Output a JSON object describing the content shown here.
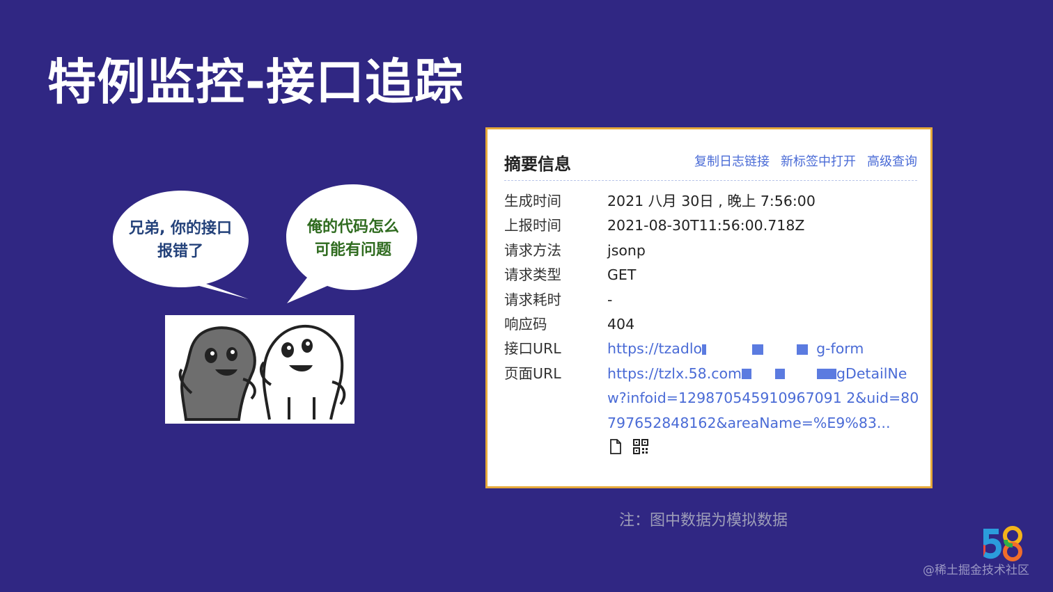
{
  "slide": {
    "title": "特例监控-接口追踪",
    "note": "注：图中数据为模拟数据",
    "watermark": "@稀土掘金技术社区"
  },
  "bubbles": {
    "left": {
      "line1": "兄弟, 你的接口",
      "line2": "报错了"
    },
    "right": {
      "line1": "俺的代码怎么",
      "line2": "可能有问题"
    }
  },
  "panel": {
    "title": "摘要信息",
    "actions": [
      "复制日志链接",
      "新标签中打开",
      "高级查询"
    ],
    "rows": [
      {
        "label": "生成时间",
        "value": "2021 八月 30日 , 晚上 7:56:00"
      },
      {
        "label": "上报时间",
        "value": "2021-08-30T11:56:00.718Z"
      },
      {
        "label": "请求方法",
        "value": "jsonp"
      },
      {
        "label": "请求类型",
        "value": "GET"
      },
      {
        "label": "请求耗时",
        "value": "-"
      },
      {
        "label": "响应码",
        "value": "404"
      },
      {
        "label": "接口URL",
        "value_start": "https://tzadlo",
        "value_end": "g-form"
      },
      {
        "label": "页面URL",
        "value_start": "https://tzlx.58.com",
        "value_end": "gDetailNe",
        "value_rest": "w?infoid=129870545910967091 2&uid=80797652848162&areaName=%E9%83..."
      }
    ],
    "icons": [
      "document-icon",
      "qr-code-icon"
    ]
  },
  "colors": {
    "background": "#302783",
    "panel_border": "#e6a93a",
    "link": "#4a6bd6"
  }
}
